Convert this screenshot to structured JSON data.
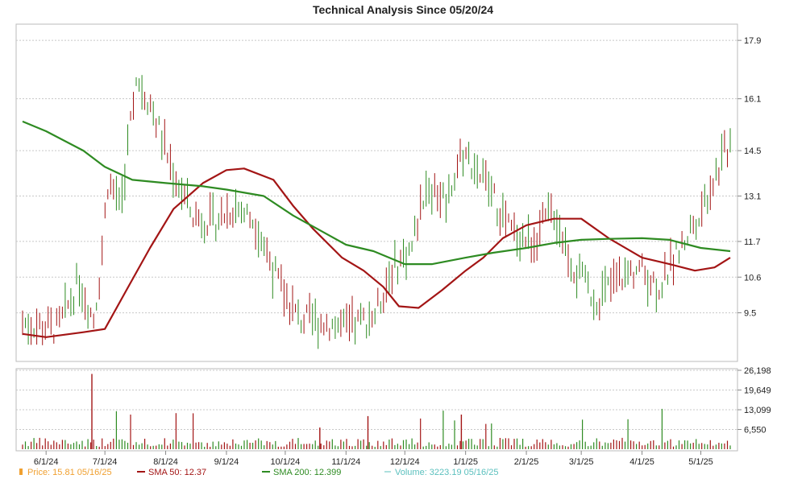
{
  "chart_data": {
    "type": "line",
    "title": "Technical Analysis Since 05/20/24",
    "price_axis": {
      "ylim": [
        8.0,
        18.4
      ],
      "ticks": [
        "17.9",
        "16.1",
        "14.5",
        "13.1",
        "11.7",
        "10.6",
        "9.5"
      ],
      "tick_values": [
        17.9,
        16.1,
        14.5,
        13.1,
        11.7,
        10.6,
        9.5
      ]
    },
    "volume_axis": {
      "ylim": [
        0,
        26198
      ],
      "ticks": [
        "26,198",
        "19,649",
        "13,099",
        "6,550"
      ],
      "tick_values": [
        26198,
        19649,
        13099,
        6550
      ]
    },
    "x_axis": {
      "start_date": "05/20/24",
      "end_date": "05/16/25",
      "ticks": [
        "6/1/24",
        "7/1/24",
        "8/1/24",
        "9/1/24",
        "10/1/24",
        "11/1/24",
        "12/1/24",
        "1/1/25",
        "2/1/25",
        "3/1/25",
        "4/1/25",
        "5/1/25"
      ],
      "tick_dates": [
        "2024-06-01",
        "2024-07-01",
        "2024-08-01",
        "2024-09-01",
        "2024-10-01",
        "2024-11-01",
        "2024-12-01",
        "2025-01-01",
        "2025-02-01",
        "2025-03-01",
        "2025-04-01",
        "2025-05-01"
      ]
    },
    "grid": true,
    "series": [
      {
        "name": "SMA 50",
        "color": "#a31515",
        "points": [
          [
            "2024-05-20",
            8.85
          ],
          [
            "2024-06-01",
            8.75
          ],
          [
            "2024-06-20",
            8.9
          ],
          [
            "2024-07-01",
            9.0
          ],
          [
            "2024-07-12",
            10.2
          ],
          [
            "2024-07-24",
            11.5
          ],
          [
            "2024-08-05",
            12.7
          ],
          [
            "2024-08-20",
            13.5
          ],
          [
            "2024-09-01",
            13.9
          ],
          [
            "2024-09-10",
            13.95
          ],
          [
            "2024-09-25",
            13.6
          ],
          [
            "2024-10-05",
            12.8
          ],
          [
            "2024-10-15",
            12.1
          ],
          [
            "2024-10-30",
            11.2
          ],
          [
            "2024-11-10",
            10.8
          ],
          [
            "2024-11-20",
            10.3
          ],
          [
            "2024-11-28",
            9.7
          ],
          [
            "2024-12-08",
            9.65
          ],
          [
            "2024-12-20",
            10.2
          ],
          [
            "2025-01-01",
            10.8
          ],
          [
            "2025-01-10",
            11.2
          ],
          [
            "2025-01-20",
            11.8
          ],
          [
            "2025-02-01",
            12.2
          ],
          [
            "2025-02-15",
            12.4
          ],
          [
            "2025-03-01",
            12.4
          ],
          [
            "2025-03-15",
            11.8
          ],
          [
            "2025-04-01",
            11.2
          ],
          [
            "2025-04-15",
            11.0
          ],
          [
            "2025-04-28",
            10.8
          ],
          [
            "2025-05-08",
            10.9
          ],
          [
            "2025-05-16",
            11.2
          ]
        ]
      },
      {
        "name": "SMA 200",
        "color": "#2e8b22",
        "points": [
          [
            "2024-05-20",
            15.4
          ],
          [
            "2024-06-01",
            15.1
          ],
          [
            "2024-06-20",
            14.5
          ],
          [
            "2024-07-01",
            14.0
          ],
          [
            "2024-07-15",
            13.6
          ],
          [
            "2024-08-01",
            13.5
          ],
          [
            "2024-08-20",
            13.4
          ],
          [
            "2024-09-01",
            13.3
          ],
          [
            "2024-09-20",
            13.1
          ],
          [
            "2024-10-05",
            12.5
          ],
          [
            "2024-10-20",
            12.0
          ],
          [
            "2024-11-01",
            11.6
          ],
          [
            "2024-11-15",
            11.4
          ],
          [
            "2024-12-01",
            11.0
          ],
          [
            "2024-12-15",
            11.0
          ],
          [
            "2025-01-01",
            11.2
          ],
          [
            "2025-01-15",
            11.35
          ],
          [
            "2025-02-01",
            11.5
          ],
          [
            "2025-02-15",
            11.65
          ],
          [
            "2025-03-01",
            11.75
          ],
          [
            "2025-03-15",
            11.78
          ],
          [
            "2025-04-01",
            11.8
          ],
          [
            "2025-04-15",
            11.75
          ],
          [
            "2025-05-01",
            11.5
          ],
          [
            "2025-05-16",
            11.4
          ]
        ]
      }
    ],
    "volume_marker_color": "#5bc0be",
    "legend_placement": "bottom",
    "legend": {
      "price": {
        "label": "Price: 15.81  05/16/25",
        "color": "#f0a030"
      },
      "sma50": {
        "label": "SMA 50: 12.37",
        "color": "#a31515"
      },
      "sma200": {
        "label": "SMA 200: 12.399",
        "color": "#2e8b22"
      },
      "volume": {
        "label": "Volume: 3223.19  05/16/25",
        "color": "#5bc0be"
      }
    }
  }
}
